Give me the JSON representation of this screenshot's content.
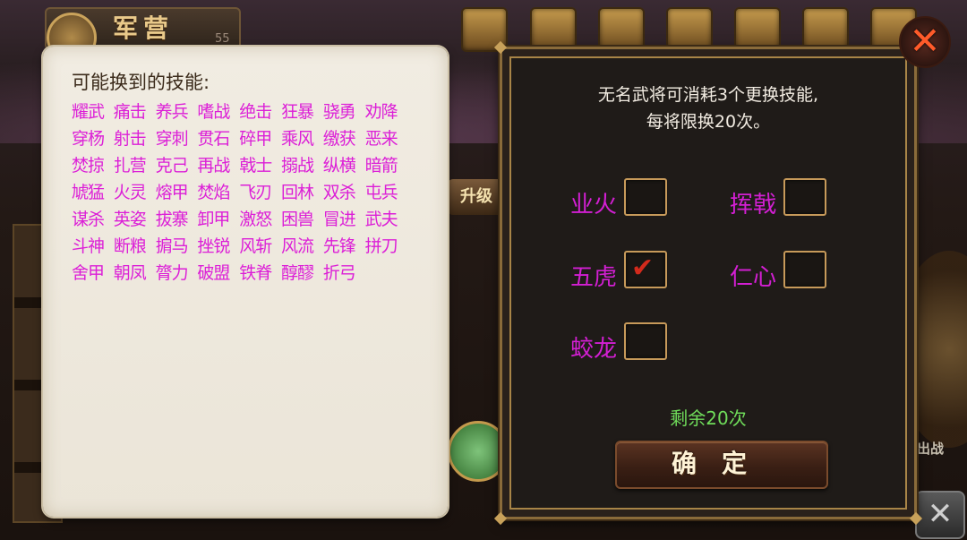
{
  "background": {
    "title": "军营",
    "level": "55",
    "upgrade_label": "升级",
    "deploy_label": "出战"
  },
  "left_panel": {
    "title": "可能换到的技能:",
    "skills": [
      "耀武",
      "痛击",
      "养兵",
      "嗜战",
      "绝击",
      "狂暴",
      "骁勇",
      "劝降",
      "穿杨",
      "射击",
      "穿刺",
      "贯石",
      "碎甲",
      "乘风",
      "缴获",
      "恶来",
      "焚掠",
      "扎营",
      "克己",
      "再战",
      "戟士",
      "搦战",
      "纵横",
      "暗箭",
      "虓猛",
      "火灵",
      "熔甲",
      "焚焰",
      "飞刃",
      "回林",
      "双杀",
      "屯兵",
      "谋杀",
      "英姿",
      "拔寨",
      "卸甲",
      "激怒",
      "困兽",
      "冒进",
      "武夫",
      "斗神",
      "断粮",
      "掮马",
      "挫锐",
      "风斩",
      "风流",
      "先锋",
      "拼刀",
      "舍甲",
      "朝凤",
      "膂力",
      "破盟",
      "铁脊",
      "醇醪",
      "折弓"
    ]
  },
  "right_panel": {
    "info_line1": "无名武将可消耗3个更换技能,",
    "info_line2": "每将限换20次。",
    "options": [
      {
        "label": "业火",
        "checked": false
      },
      {
        "label": "挥戟",
        "checked": false
      },
      {
        "label": "五虎",
        "checked": true
      },
      {
        "label": "仁心",
        "checked": false
      },
      {
        "label": "蛟龙",
        "checked": false
      }
    ],
    "remaining": "剩余20次",
    "confirm_label": "确定"
  },
  "close_icon": "✕",
  "colors": {
    "skill_text": "#dc1fd7",
    "option_label": "#d31fd3",
    "remaining_text": "#6fdc5a",
    "checkmark": "#d32a1c",
    "frame_border": "#a88547"
  }
}
